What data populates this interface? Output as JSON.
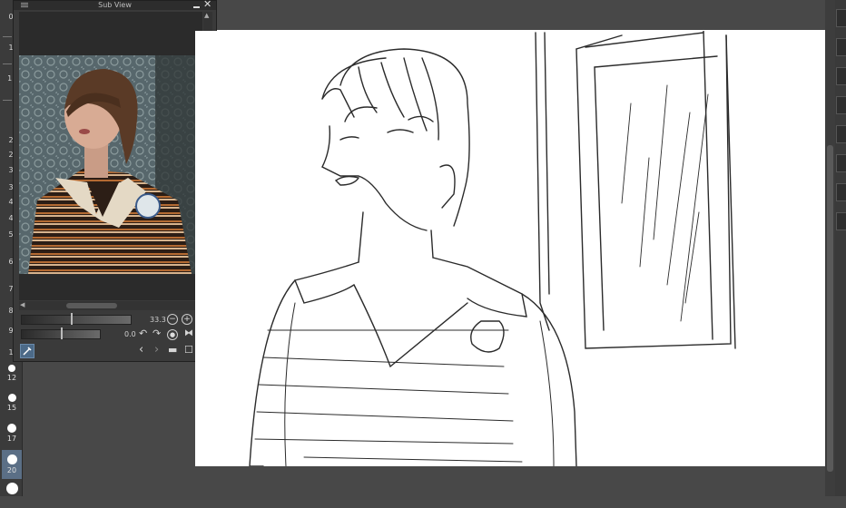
{
  "subview": {
    "title": "Sub View",
    "zoom_value": "33.3",
    "rotation_value": "0.0"
  },
  "brush_strip": {
    "top_labels": [
      "0",
      "1",
      "1.",
      "2",
      "2",
      "3",
      "3",
      "4",
      "4",
      "5",
      "6",
      "7",
      "8",
      "9",
      "1"
    ],
    "sizes": [
      {
        "label": "12",
        "selected": false
      },
      {
        "label": "15",
        "selected": false
      },
      {
        "label": "17",
        "selected": false
      },
      {
        "label": "20",
        "selected": true
      }
    ],
    "accent_color": "#5b6f86"
  },
  "colors": {
    "workspace": "#484848",
    "canvas": "#ffffff",
    "panel": "#3a3a3a"
  }
}
